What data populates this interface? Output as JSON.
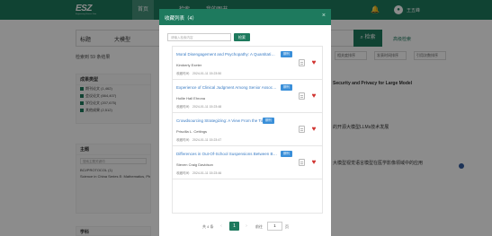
{
  "header": {
    "logo_text": "ESZ",
    "logo_subtitle": "Engineering Science Data",
    "nav": [
      "首页",
      "检索",
      "我的图书"
    ],
    "username": "王五峰"
  },
  "search": {
    "field_select": "标题",
    "keyword": "大模型",
    "button_label": "检索",
    "advanced_label": "高级检索"
  },
  "results": {
    "count_text": "检索到 59 条结果",
    "sort_options": [
      "相关度排序",
      "发表时间排序",
      "引用次数排序"
    ]
  },
  "facets": {
    "type": {
      "title": "成果类型",
      "items": [
        "期刊论文 (1,462)",
        "会议论文 (664,407)",
        "学位论文 (207,675)",
        "其他成果 (2,512)"
      ]
    },
    "topic": {
      "title": "主题",
      "search_placeholder": "搜索主题关键词",
      "items": [
        "BCI/PROTOCOL (1)",
        "Science in China Series E: Mathematics, Physics, Astronomy & Technological Sciences (in Chinese)"
      ]
    },
    "discipline": {
      "title": "学科"
    }
  },
  "background_titles": [
    "Security and Privacy for Large Model",
    "的开源大模型LLMs技术发展",
    "大模型视觉语言模型在医学影像领域中的应用"
  ],
  "modal": {
    "title": "收藏列表（4）",
    "search_placeholder": "请输入检索内容",
    "search_button": "检索",
    "time_label": "收藏时间:",
    "items": [
      {
        "title": "Moral Disengagement and Psychopathy: A Quantitative Analysis",
        "badge": "期刊",
        "author": "Kimberly Exeter",
        "time": "2024-01-11 15:23:50"
      },
      {
        "title": "Experience of Clinical Judgment Among Senior Associates",
        "badge": "期刊",
        "author": "Hollie Hall Ehrona",
        "time": "2024-01-11 15:23:48"
      },
      {
        "title": "Crowdsourcing Strategizing: A View From the Top",
        "badge": "期刊",
        "author": "Priscilla L. Cettings",
        "time": "2024-01-11 15:23:47"
      },
      {
        "title": "Differences in Out-Of-School Suspensions Between Black Students",
        "badge": "期刊",
        "author": "Steven Craig Davidson",
        "time": "2024-01-11 15:23:46"
      }
    ],
    "pagination": {
      "total_text": "共 4 条",
      "current_page": "1",
      "goto_label": "前往",
      "goto_value": "1",
      "page_unit": "页"
    }
  },
  "colors": {
    "brand": "#1e7a5e",
    "badge": "#3a8fd9",
    "heart": "#d0322f",
    "link": "#3a7cc4"
  }
}
